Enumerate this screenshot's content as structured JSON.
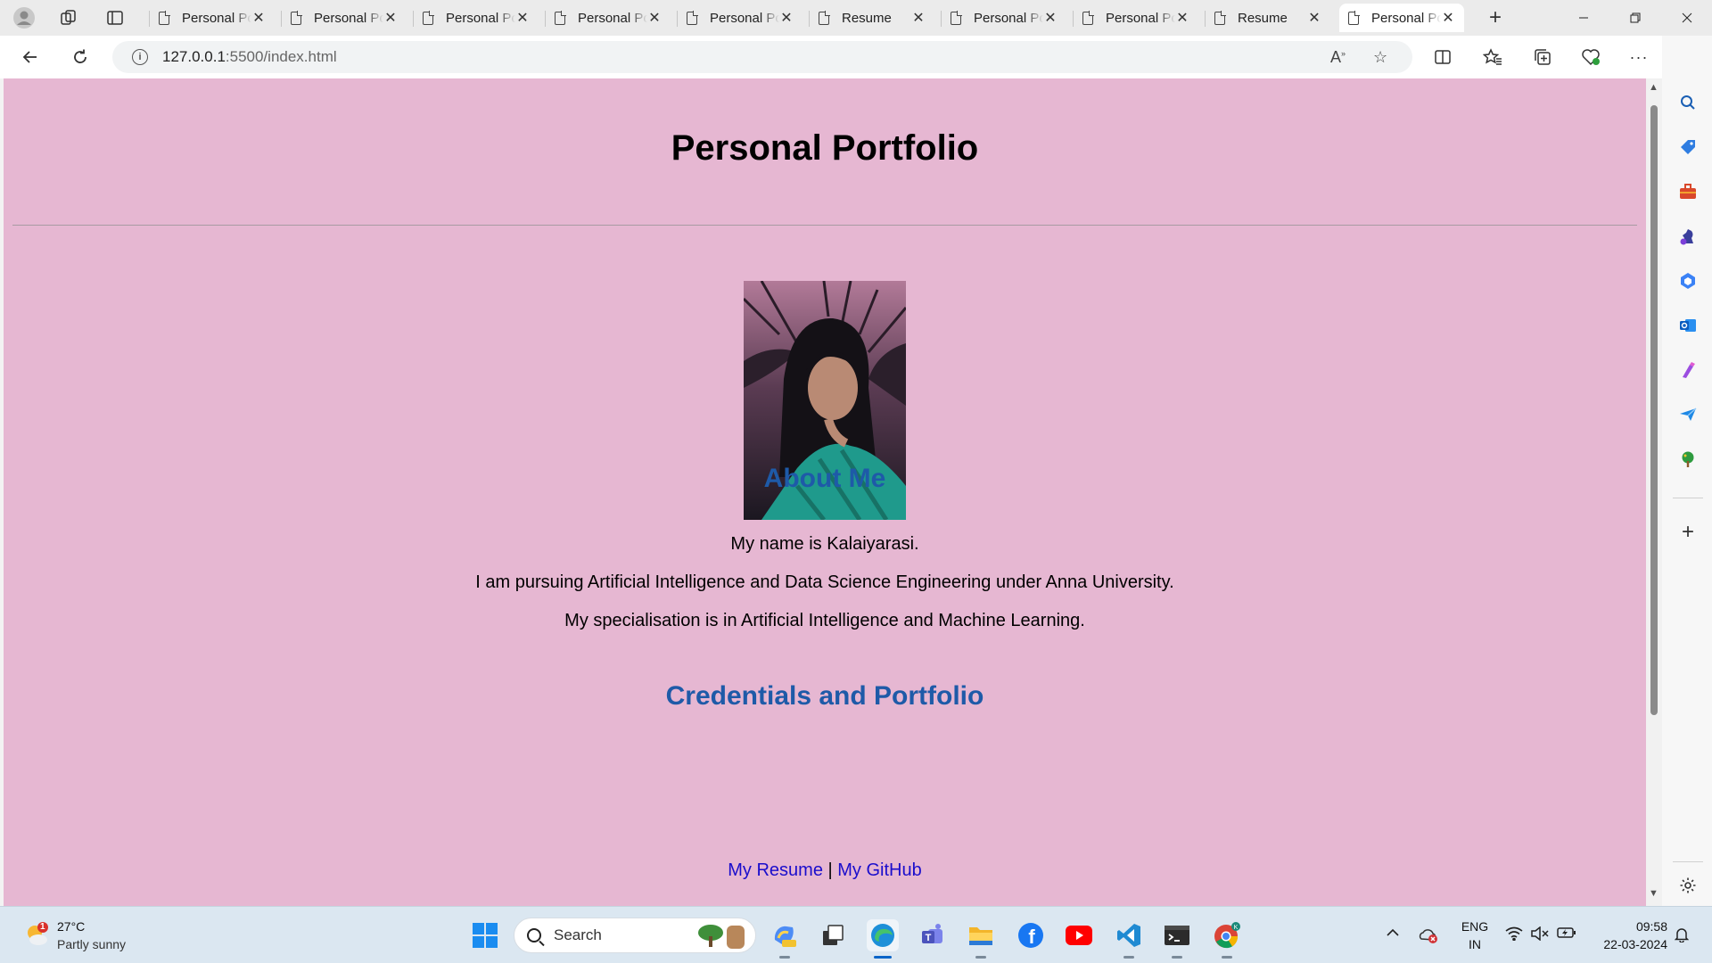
{
  "browser": {
    "tabs": [
      {
        "title": "Personal Portfolio"
      },
      {
        "title": "Personal Portfolio"
      },
      {
        "title": "Personal Portfolio"
      },
      {
        "title": "Personal Portfolio"
      },
      {
        "title": "Personal Portfolio"
      },
      {
        "title": "Resume"
      },
      {
        "title": "Personal Portfolio"
      },
      {
        "title": "Personal Portfolio"
      },
      {
        "title": "Resume"
      },
      {
        "title": "Personal Portfolio"
      }
    ],
    "url_host": "127.0.0.1",
    "url_rest": ":5500/index.html"
  },
  "page": {
    "title": "Personal Portfolio",
    "about_heading": "About Me",
    "about_lines": [
      "My name is Kalaiyarasi.",
      "I am pursuing Artificial Intelligence and Data Science Engineering under Anna University.",
      "My specialisation is in Artificial Intelligence and Machine Learning."
    ],
    "credentials_heading": "Credentials and Portfolio",
    "link_resume": "My Resume",
    "link_separator": " | ",
    "link_github": "My GitHub"
  },
  "taskbar": {
    "weather_temp": "27°C",
    "weather_desc": "Partly sunny",
    "weather_badge": "1",
    "search_placeholder": "Search",
    "lang_top": "ENG",
    "lang_bottom": "IN",
    "time": "09:58",
    "date": "22-03-2024"
  },
  "colors": {
    "page_background": "#e6b7d2",
    "heading_blue": "#1e5aa8",
    "link_blue": "#1a0dcc"
  }
}
